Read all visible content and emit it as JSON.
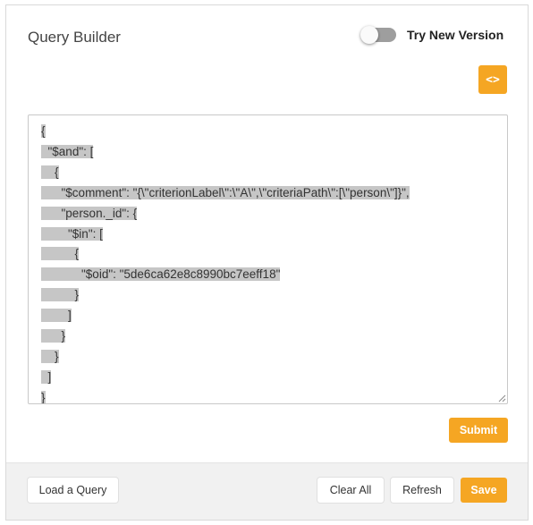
{
  "header": {
    "title": "Query Builder",
    "toggle_label": "Try New Version",
    "toggle_on": false,
    "code_button_label": "<>"
  },
  "editor": {
    "lines": [
      "{",
      "  \"$and\": [",
      "    {",
      "      \"$comment\": \"{\\\"criterionLabel\\\":\\\"A\\\",\\\"criteriaPath\\\":[\\\"person\\\"]}\",",
      "      \"person._id\": {",
      "        \"$in\": [",
      "          {",
      "            \"$oid\": \"5de6ca62e8c8990bc7eeff18\"",
      "          }",
      "        ]",
      "      }",
      "    }",
      "  ]",
      "}"
    ]
  },
  "actions": {
    "submit_label": "Submit",
    "load_label": "Load a Query",
    "clear_label": "Clear All",
    "refresh_label": "Refresh",
    "save_label": "Save"
  },
  "colors": {
    "accent": "#f5a623",
    "selection": "#c6c6c6"
  }
}
